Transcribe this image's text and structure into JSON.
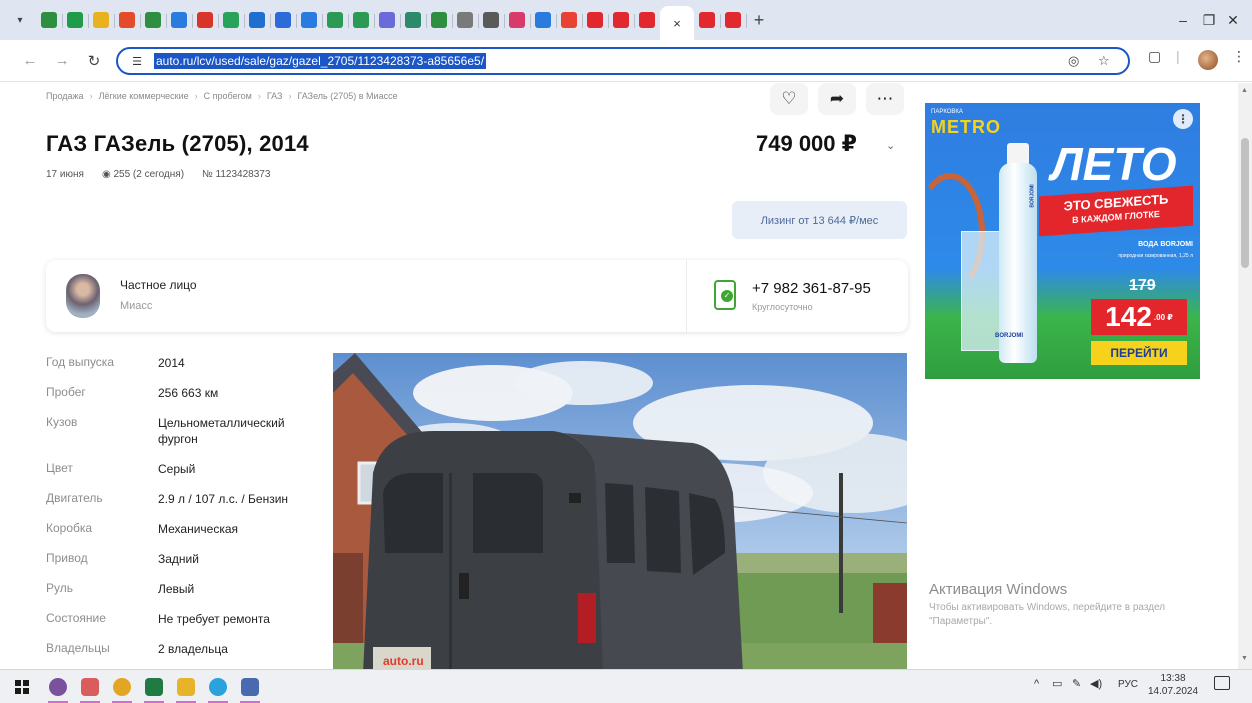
{
  "browser": {
    "tabs": [
      {
        "color": "#2d8f3f"
      },
      {
        "color": "#1f9b4a"
      },
      {
        "color": "#e8b21e"
      },
      {
        "color": "#e34b2a"
      },
      {
        "color": "#2d8f3f"
      },
      {
        "color": "#2a7be0"
      },
      {
        "color": "#d8342a"
      },
      {
        "color": "#29a35a"
      },
      {
        "color": "#1e6fd0"
      },
      {
        "color": "#2c6bd8"
      },
      {
        "color": "#2a7be0"
      },
      {
        "color": "#2a9a54"
      },
      {
        "color": "#2a9a54"
      },
      {
        "color": "#6a6ad8"
      },
      {
        "color": "#2a8a6a"
      },
      {
        "color": "#2d8f3f"
      },
      {
        "color": "#7a7a7a"
      },
      {
        "color": "#5a5a5a"
      },
      {
        "color": "#d83a6a"
      },
      {
        "color": "#2a7be0"
      },
      {
        "color": "#e94235"
      },
      {
        "color": "#e0282e"
      },
      {
        "color": "#e0282e"
      },
      {
        "color": "#e0282e"
      }
    ],
    "active_tab_close": "×",
    "tabs_after": [
      {
        "color": "#e0282e"
      },
      {
        "color": "#e0282e"
      }
    ],
    "new_tab": "+",
    "window": {
      "minimize": "–",
      "restore": "❐",
      "close": "✕"
    },
    "url": "auto.ru/lcv/used/sale/gaz/gazel_2705/1123428373-a85656e5/"
  },
  "page": {
    "breadcrumb": [
      "Продажа",
      "Лёгкие коммерческие",
      "С пробегом",
      "ГАЗ",
      "ГАЗель (2705) в Миассе"
    ],
    "breadcrumb_sep": "›",
    "title": "ГАЗ ГАЗель (2705), 2014",
    "date": "17 июня",
    "views": "255 (2 сегодня)",
    "ad_number": "№ 1123428373",
    "price": "749 000 ₽",
    "leasing": "Лизинг от 13 644 ₽/мес",
    "seller": {
      "type": "Частное лицо",
      "city": "Миасс",
      "phone": "+7 982 361-87-95",
      "phone_note": "Круглосуточно"
    },
    "specs": [
      {
        "label": "Год выпуска",
        "value": "2014"
      },
      {
        "label": "Пробег",
        "value": "256 663 км"
      },
      {
        "label": "Кузов",
        "value": "Цельнометаллический фургон"
      },
      {
        "label": "Цвет",
        "value": "Серый"
      },
      {
        "label": "Двигатель",
        "value": "2.9 л / 107 л.с. / Бензин"
      },
      {
        "label": "Коробка",
        "value": "Механическая"
      },
      {
        "label": "Привод",
        "value": "Задний"
      },
      {
        "label": "Руль",
        "value": "Левый"
      },
      {
        "label": "Состояние",
        "value": "Не требует ремонта"
      },
      {
        "label": "Владельцы",
        "value": "2 владельца"
      }
    ],
    "photo_watermark": "auto.ru"
  },
  "ad": {
    "brand_small": "ПАРКОВКА",
    "brand": "METRO",
    "info": "⋮",
    "headline": "ЛЕТО",
    "banner_line1": "ЭТО СВЕЖЕСТЬ",
    "banner_line2": "В КАЖДОМ ГЛОТКЕ",
    "product": "ВОДА BORJOMI",
    "product_desc": "природная газированная, 1,25 л",
    "bottle_label": "BORJOMI",
    "old_price": "179",
    "price": "142",
    "price_cents": ".00 ₽",
    "cta": "ПЕРЕЙТИ"
  },
  "watermark": {
    "title": "Активация Windows",
    "subtitle": "Чтобы активировать Windows, перейдите в раздел \"Параметры\"."
  },
  "taskbar": {
    "apps": [
      {
        "name": "viber-icon",
        "color": "#7b519d",
        "round": true
      },
      {
        "name": "scissors-icon",
        "color": "#d95d5d",
        "round": false
      },
      {
        "name": "chrome-icon",
        "color": "#e5a524",
        "round": true
      },
      {
        "name": "excel-icon",
        "color": "#1f7a44",
        "round": false
      },
      {
        "name": "explorer-icon",
        "color": "#e7b32a",
        "round": false
      },
      {
        "name": "telegram-icon",
        "color": "#2aa3dc",
        "round": true
      },
      {
        "name": "document-icon",
        "color": "#4a6ab0",
        "round": false
      }
    ],
    "lang": "РУС",
    "time": "13:38",
    "date": "14.07.2024"
  }
}
